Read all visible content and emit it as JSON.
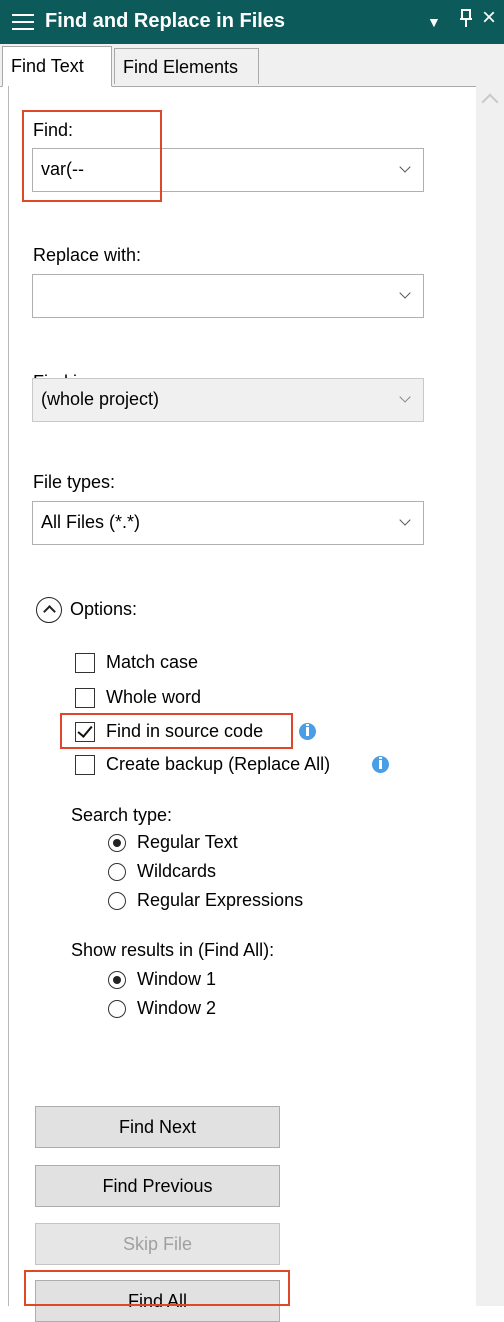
{
  "window": {
    "title": "Find and Replace in Files",
    "dropdown_glyph": "▼",
    "pin_glyph": "ᵱ",
    "close_glyph": "×"
  },
  "tabs": [
    {
      "label": "Find Text",
      "active": true
    },
    {
      "label": "Find Elements",
      "active": false
    }
  ],
  "find": {
    "label": "Find:",
    "value": "var(--"
  },
  "replace": {
    "label": "Replace with:",
    "value": ""
  },
  "find_in": {
    "label": "Find in:",
    "value": "(whole project)"
  },
  "file_types": {
    "label": "File types:",
    "value": "All Files (*.*)"
  },
  "options": {
    "label": "Options:",
    "items": [
      {
        "label": "Match case",
        "checked": false
      },
      {
        "label": "Whole word",
        "checked": false
      },
      {
        "label": "Find in source code",
        "checked": true
      },
      {
        "label": "Create backup (Replace All)",
        "checked": false
      }
    ]
  },
  "search_type": {
    "label": "Search type:",
    "options": [
      {
        "label": "Regular Text",
        "selected": true
      },
      {
        "label": "Wildcards",
        "selected": false
      },
      {
        "label": "Regular Expressions",
        "selected": false
      }
    ]
  },
  "show_results": {
    "label": "Show results in (Find All):",
    "options": [
      {
        "label": "Window 1",
        "selected": true
      },
      {
        "label": "Window 2",
        "selected": false
      }
    ]
  },
  "buttons": [
    {
      "label": "Find Next",
      "enabled": true
    },
    {
      "label": "Find Previous",
      "enabled": true
    },
    {
      "label": "Skip File",
      "enabled": false
    },
    {
      "label": "Find All",
      "enabled": true
    }
  ],
  "colors": {
    "titlebar": "#0c5a59",
    "highlight": "#e0472a",
    "info": "#4a9ee6"
  }
}
